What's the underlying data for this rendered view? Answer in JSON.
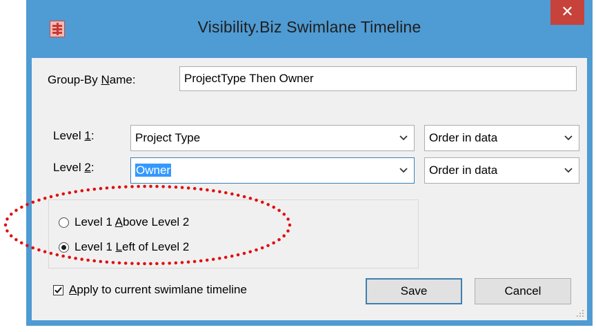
{
  "window": {
    "title": "Visibility.Biz Swimlane Timeline",
    "close_glyph": "✕",
    "app_icon": "swimlane-app-icon"
  },
  "group_by": {
    "label_pre": "Group-By ",
    "label_accel": "N",
    "label_post": "ame:",
    "value": "ProjectType Then Owner"
  },
  "level1": {
    "label_pre": "Level ",
    "label_accel": "1",
    "label_post": ":",
    "field_value": "Project Type",
    "order_value": "Order in data"
  },
  "level2": {
    "label_pre": "Level ",
    "label_accel": "2",
    "label_post": ":",
    "field_value": "Owner",
    "order_value": "Order in data"
  },
  "layout_options": {
    "above": {
      "pre": "Level 1 ",
      "accel": "A",
      "post": "bove Level 2",
      "selected": false
    },
    "left": {
      "pre": "Level 1 ",
      "accel": "L",
      "post": "eft of Level 2",
      "selected": true
    }
  },
  "apply": {
    "accel": "A",
    "post": "pply to current swimlane timeline",
    "checked": true
  },
  "buttons": {
    "save": "Save",
    "cancel": "Cancel"
  },
  "colors": {
    "frame": "#4f9bd3",
    "close": "#c7423b",
    "annotation": "#e01010",
    "selection": "#3399ff"
  }
}
